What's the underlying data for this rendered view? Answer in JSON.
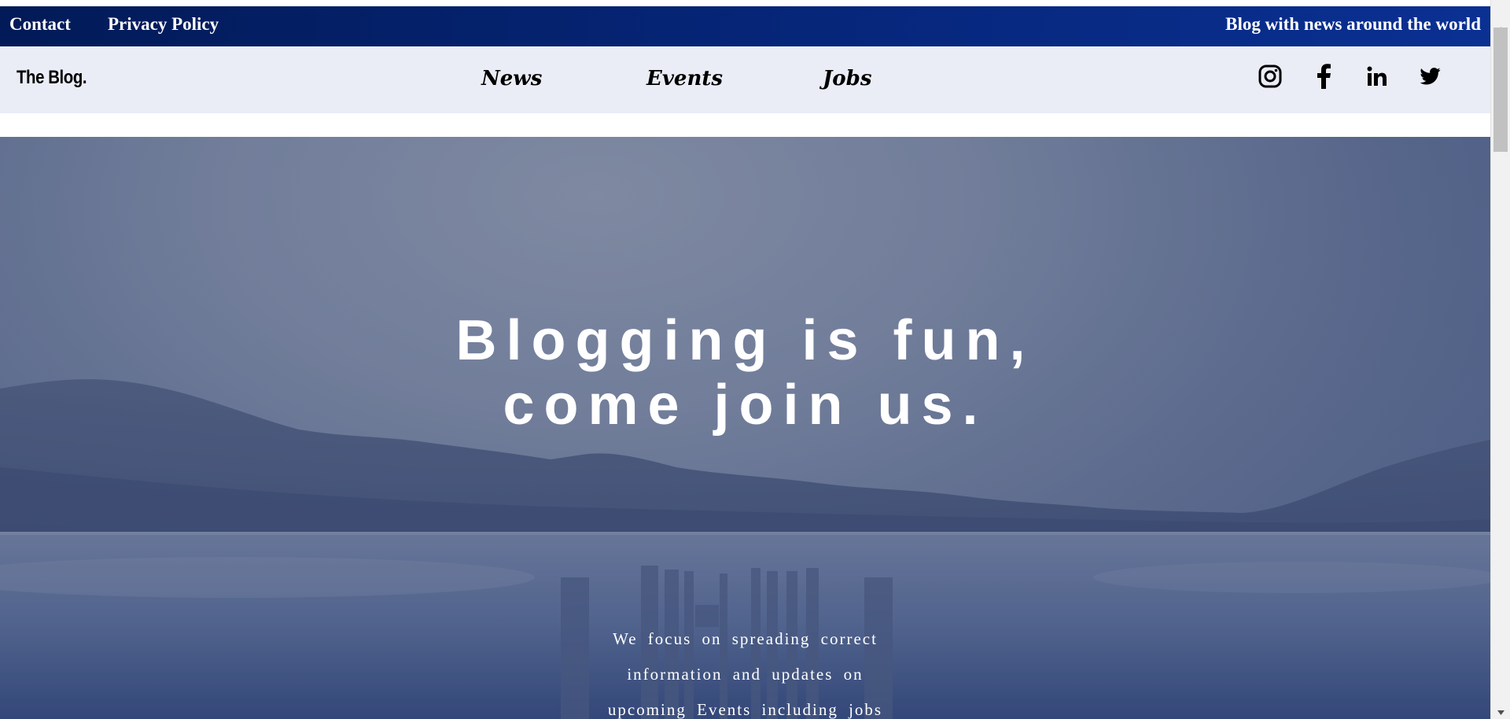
{
  "topbar": {
    "contact_label": "Contact",
    "privacy_label": "Privacy Policy",
    "tagline": "Blog with news around the world",
    "bg_color": "#06267a"
  },
  "navbar": {
    "brand": "The Blog.",
    "links": [
      {
        "label": "News"
      },
      {
        "label": "Events"
      },
      {
        "label": "Jobs"
      }
    ],
    "social_icons": [
      "instagram-icon",
      "facebook-icon",
      "linkedin-icon",
      "twitter-icon"
    ],
    "bg_color": "#eaedf6"
  },
  "hero": {
    "title_line1": "Blogging is fun,",
    "title_line2": "come join us.",
    "subtitle_line1": "We focus on spreading correct",
    "subtitle_line2": "information and updates on",
    "subtitle_line3": "upcoming Events including jobs",
    "tint_color": "#425580"
  }
}
